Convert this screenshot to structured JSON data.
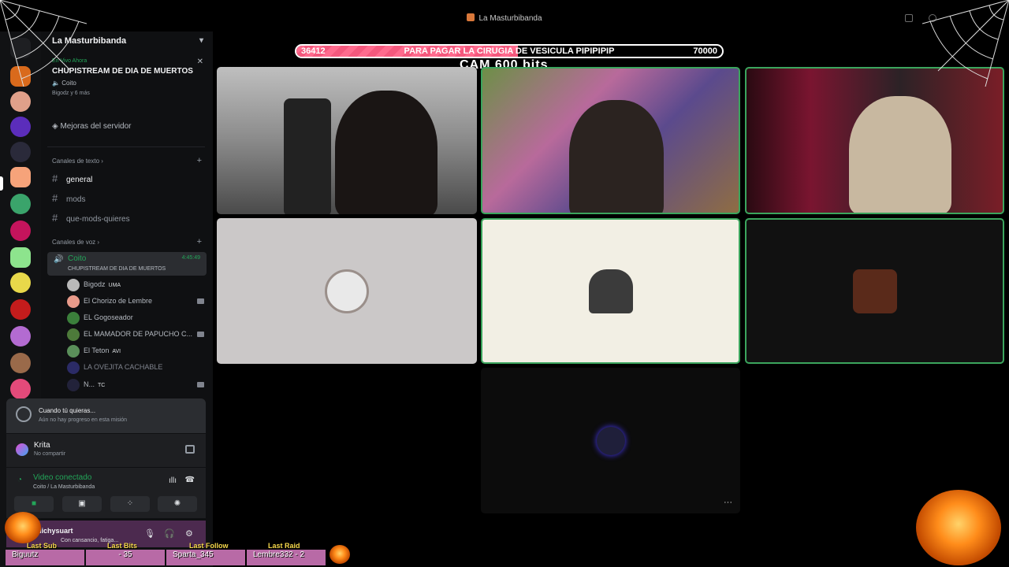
{
  "window": {
    "title": "La Masturbibanda"
  },
  "guild": {
    "name": "La Masturbibanda"
  },
  "event": {
    "live_label": "En Vivo Ahora",
    "title": "CHUPISTREAM DE DIA DE MUERTOS",
    "channel": "Coito",
    "users": "Bigodz y 6 más"
  },
  "boost_label": "Mejoras del servidor",
  "text_category": "Canales de texto",
  "text_channels": [
    "general",
    "mods",
    "que-mods-quieres"
  ],
  "voice_category": "Canales de voz",
  "voice_channel": {
    "name": "Coito",
    "time": "4:45:49",
    "event": "CHUPISTREAM DE DIA DE MUERTOS"
  },
  "voice_users": [
    {
      "name": "Bigodz",
      "badge": "UMA",
      "color": "#b9b9b9"
    },
    {
      "name": "El Chorizo de Lembre",
      "badge": "",
      "color": "#e89a8a"
    },
    {
      "name": "EL Gogoseador",
      "badge": "",
      "color": "#3b7f3b"
    },
    {
      "name": "EL MAMADOR DE PAPUCHO C...",
      "badge": "",
      "color": "#4d7a3a"
    },
    {
      "name": "El Teton",
      "badge": "AVI",
      "color": "#5a8f5a"
    },
    {
      "name": "LA OVEJITA CACHABLE",
      "badge": "",
      "color": "#2b2b66"
    },
    {
      "name": "N...",
      "badge": "TC",
      "color": "#22223a"
    }
  ],
  "quest": {
    "title": "Cuando tú quieras...",
    "subtitle": "Aún no hay progreso en esta misión"
  },
  "activity": {
    "name": "Krita",
    "status": "No compartir"
  },
  "voice_connection": {
    "status": "Video conectado",
    "location": "Coito / La Masturbibanda"
  },
  "user": {
    "name": "lichysuart",
    "status": "Con cansancio, fatiga..."
  },
  "stream_goal": {
    "current": "36412",
    "title": "PARA PAGAR LA CIRUGIA DE VESICULA PIPIPIPIP",
    "target": "70000",
    "progress": 0.52
  },
  "bits_text": "CAM 600 bits",
  "more_label": "···",
  "overlay_bar": {
    "labels": [
      "Last Sub",
      "Last Bits",
      "Last Follow",
      "Last Raid"
    ],
    "values": [
      "Biguutz",
      "- 35",
      "Sparta_345",
      "Lembre332 - 2"
    ]
  },
  "colors": {
    "speaking_border": "#3ba55d",
    "accent_green": "#23a559",
    "goal_fill": "#ff6b8e"
  }
}
